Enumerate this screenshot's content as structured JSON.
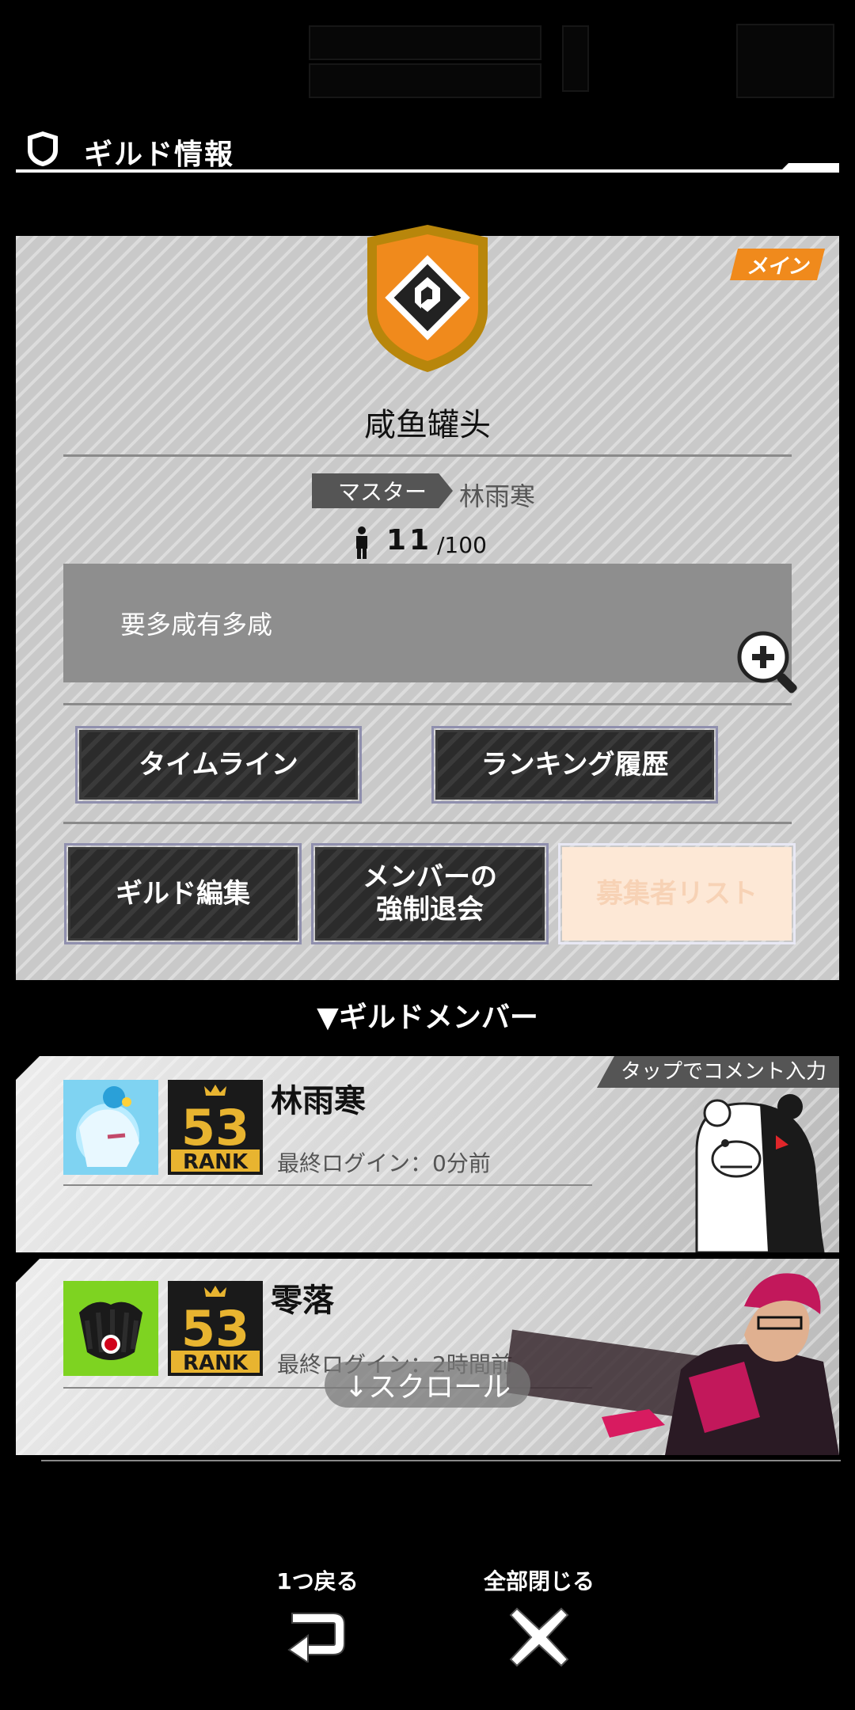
{
  "header": {
    "title": "ギルド情報"
  },
  "guild": {
    "tag": "メイン",
    "name": "咸鱼罐头",
    "master_label": "マスター",
    "master_name": "林雨寒",
    "member_count": "11",
    "member_max": "/100",
    "description": "要多咸有多咸"
  },
  "buttons": {
    "timeline": "タイムライン",
    "ranking_history": "ランキング履歴",
    "guild_edit": "ギルド編集",
    "force_leave_line1": "メンバーの",
    "force_leave_line2": "強制退会",
    "applicant_list": "募集者リスト"
  },
  "members_section": {
    "title": "▼ギルドメンバー"
  },
  "members": [
    {
      "name": "林雨寒",
      "rank_top": "53",
      "rank_bottom": "RANK",
      "last_login": "最終ログイン：0分前",
      "comment_tag": "タップでコメント入力"
    },
    {
      "name": "零落",
      "rank_top": "53",
      "rank_bottom": "RANK",
      "last_login": "最終ログイン：2時間前"
    }
  ],
  "scroll_hint": "↓スクロール",
  "footer": {
    "back_label": "1つ戻る",
    "close_all_label": "全部閉じる"
  },
  "colors": {
    "accent_orange": "#f08a1c",
    "panel_gray": "#c9c9c9",
    "rank_gold": "#e8b430"
  }
}
